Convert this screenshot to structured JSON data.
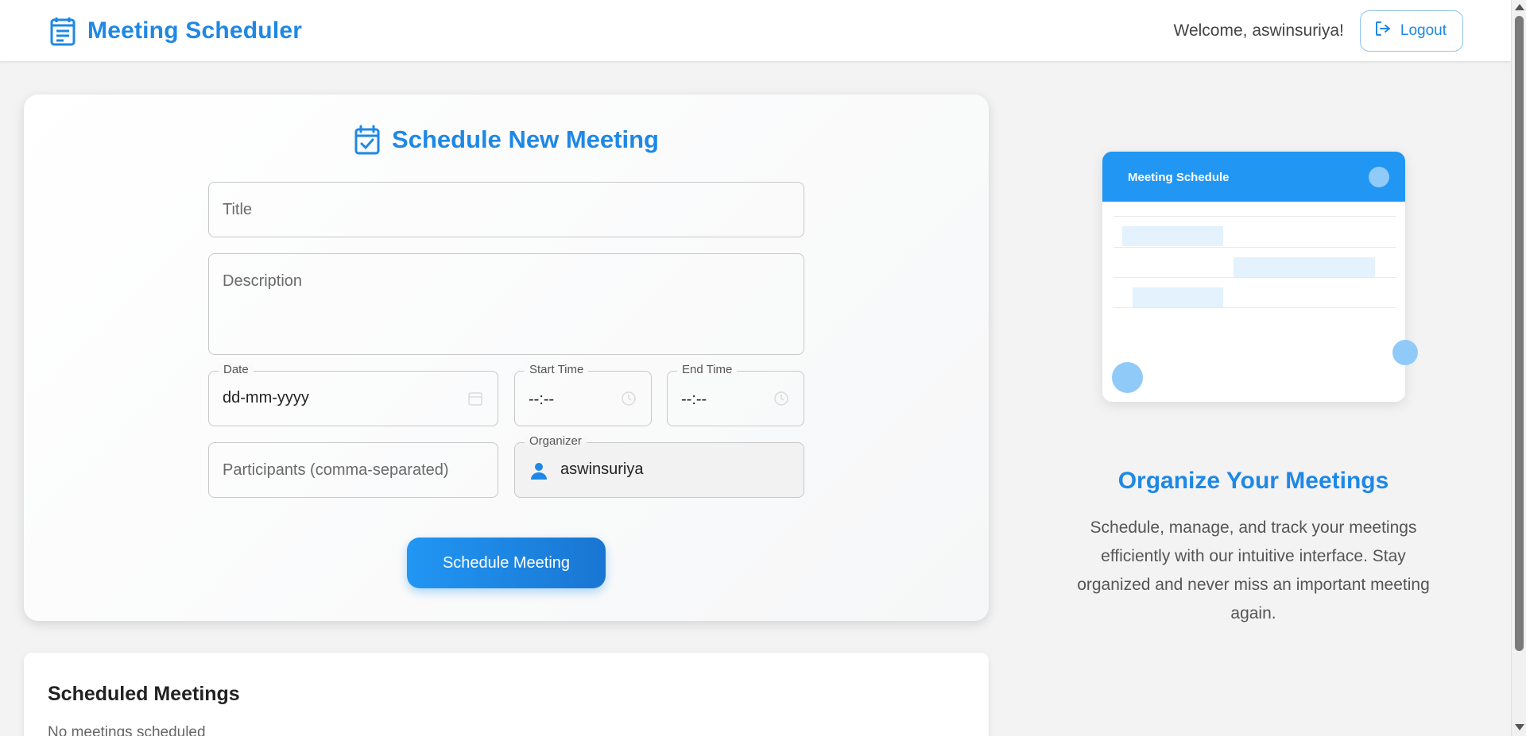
{
  "header": {
    "title": "Meeting Scheduler",
    "welcome": "Welcome, aswinsuriya!",
    "logout_label": "Logout",
    "brand_icon": "list-document-icon",
    "logout_icon": "logout-arrow-icon"
  },
  "form": {
    "heading": "Schedule New Meeting",
    "heading_icon": "calendar-check-icon",
    "title_placeholder": "Title",
    "description_placeholder": "Description",
    "date_label": "Date",
    "date_value": "dd-mm-yyyy",
    "start_time_label": "Start Time",
    "start_time_value": "--:--",
    "end_time_label": "End Time",
    "end_time_value": "--:--",
    "participants_placeholder": "Participants (comma-separated)",
    "organizer_label": "Organizer",
    "organizer_value": "aswinsuriya",
    "organizer_icon": "person-icon",
    "submit_label": "Schedule Meeting"
  },
  "scheduled": {
    "heading": "Scheduled Meetings",
    "empty_text": "No meetings scheduled"
  },
  "illustration": {
    "header_text": "Meeting Schedule"
  },
  "promo": {
    "title": "Organize Your Meetings",
    "text": "Schedule, manage, and track your meetings efficiently with our intuitive interface. Stay organized and never miss an important meeting again."
  },
  "colors": {
    "accent": "#1e88e5",
    "button_gradient_start": "#2196f3",
    "button_gradient_end": "#1976d2",
    "illustration_light": "#e3f2fd",
    "illustration_bubble": "#90caf9"
  }
}
